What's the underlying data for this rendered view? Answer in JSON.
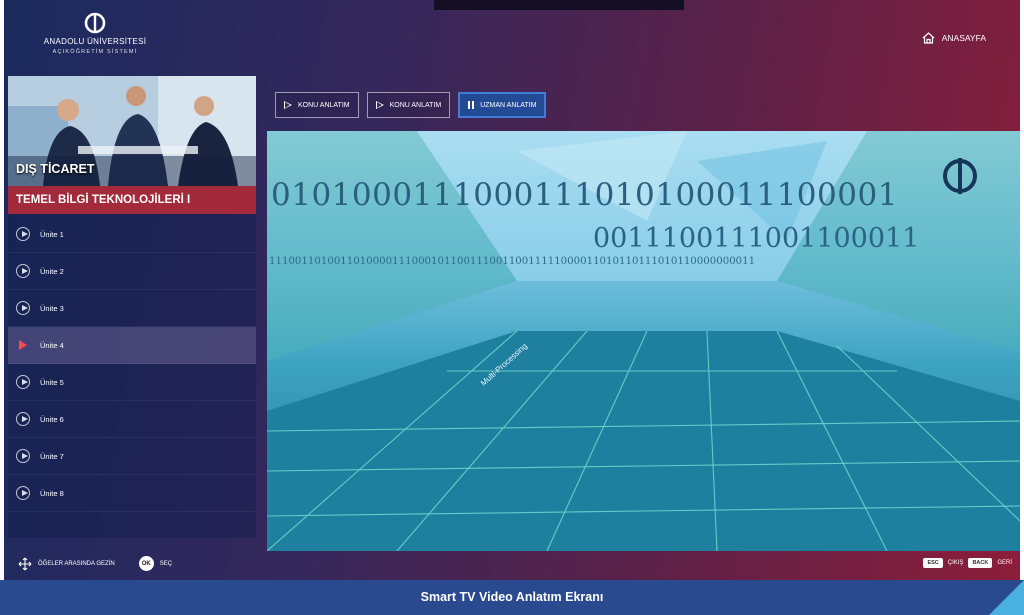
{
  "logo": {
    "university": "ANADOLU ÜNİVERSİTESİ",
    "system": "AÇIKÖĞRETİM SİSTEMİ"
  },
  "header": {
    "home_label": "ANASAYFA"
  },
  "sidebar": {
    "category": "DIŞ TİCARET",
    "course_title": "TEMEL BİLGİ TEKNOLOJİLERİ I",
    "units": [
      {
        "label": "Ünite 1"
      },
      {
        "label": "Ünite 2"
      },
      {
        "label": "Ünite 3"
      },
      {
        "label": "Ünite 4",
        "active": true
      },
      {
        "label": "Ünite 5"
      },
      {
        "label": "Ünite 6"
      },
      {
        "label": "Ünite 7"
      },
      {
        "label": "Ünite 8"
      }
    ]
  },
  "tabs": [
    {
      "label": "KONU ANLATIM",
      "icon": "play-icon"
    },
    {
      "label": "KONU ANLATIM",
      "icon": "play-icon"
    },
    {
      "label": "UZMAN ANLATIM",
      "icon": "pause-icon",
      "active": true
    }
  ],
  "video": {
    "binary_line1": "0101000111000111010100011100001",
    "binary_line2": "0011100111001100011",
    "binary_line3": "111001101001101000011100010110011100110011111000011010110111010110000000011",
    "floor_text": "Multi-Processing"
  },
  "footer": {
    "navigate_label": "ÖĞELER ARASINDA GEZİN",
    "ok_key": "OK",
    "select_label": "SEÇ",
    "esc_key": "ESC",
    "exit_label": "ÇIKIŞ",
    "back_key": "BACK",
    "back_label": "GERİ"
  },
  "caption": "Smart TV Video Anlatım Ekranı",
  "colors": {
    "accent_red": "#a32a3a",
    "active_tab": "#234b95",
    "caption_bg": "#2a4a8f"
  }
}
